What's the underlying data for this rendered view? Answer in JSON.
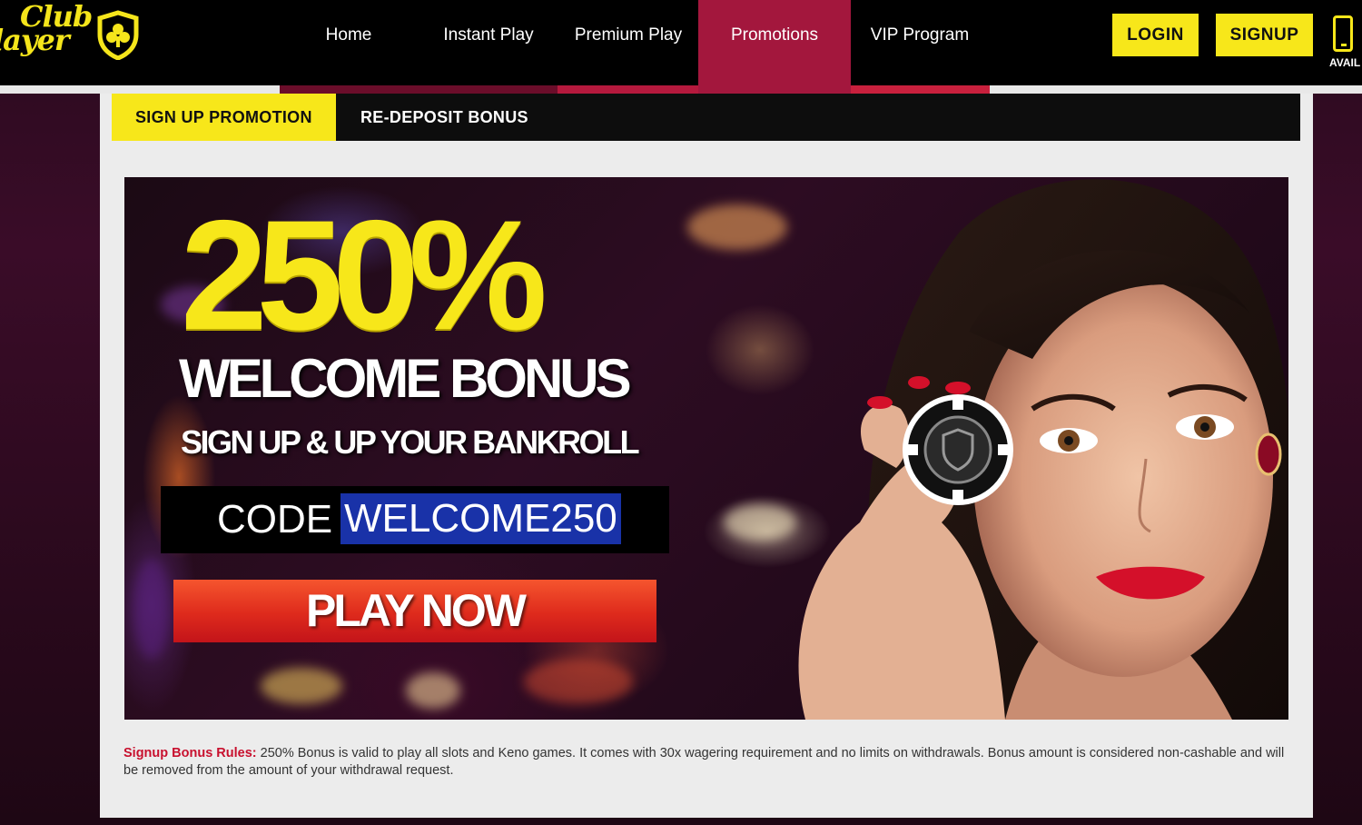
{
  "brand": {
    "logo_line1": "Club",
    "logo_line2": "layer"
  },
  "nav": {
    "items": [
      {
        "label": "Home"
      },
      {
        "label": "Instant Play"
      },
      {
        "label": "Premium Play"
      },
      {
        "label": "Promotions",
        "active": true
      },
      {
        "label": "VIP Program"
      }
    ],
    "login_label": "LOGIN",
    "signup_label": "SIGNUP",
    "mobile_label": "AVAIL"
  },
  "promo_tabs": [
    {
      "label": "SIGN UP PROMOTION",
      "active": true
    },
    {
      "label": "RE-DEPOSIT BONUS",
      "active": false
    }
  ],
  "banner": {
    "headline": "250%",
    "subhead": "WELCOME BONUS",
    "tagline": "SIGN UP & UP YOUR BANKROLL",
    "code_label": "CODE",
    "code_value": "WELCOME250",
    "cta": "PLAY NOW"
  },
  "rules": {
    "heading": "Signup Bonus Rules:",
    "text": " 250% Bonus is valid to play all slots and Keno games. It comes with 30x wagering requirement and no limits on withdrawals. Bonus amount is considered non-cashable and will be removed from the amount of your withdrawal request."
  },
  "colors": {
    "accent_yellow": "#f7e71a",
    "nav_active": "#a3173d",
    "cta_red": "#de2a1c",
    "rules_heading": "#c8102e"
  }
}
